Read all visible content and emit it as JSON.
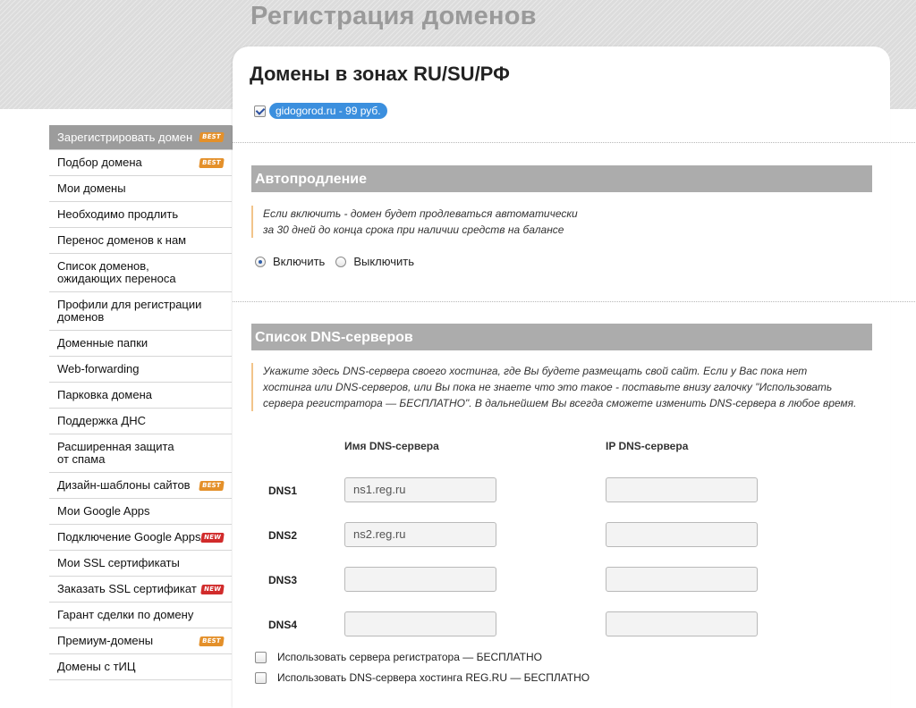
{
  "header": {
    "title": "Регистрация доменов"
  },
  "sidebar": {
    "items": [
      {
        "label": "Зарегистрировать домен",
        "badge": "BEST",
        "active": true
      },
      {
        "label": "Подбор домена",
        "badge": "BEST"
      },
      {
        "label": "Мои домены"
      },
      {
        "label": "Необходимо продлить"
      },
      {
        "label": "Перенос доменов к нам"
      },
      {
        "label": "Список доменов, ожидающих переноса"
      },
      {
        "label": "Профили для регистрации доменов"
      },
      {
        "label": "Доменные папки"
      },
      {
        "label": "Web-forwarding"
      },
      {
        "label": "Парковка домена"
      },
      {
        "label": "Поддержка ДНС"
      },
      {
        "label": "Расширенная защита от спама"
      },
      {
        "label": "Дизайн-шаблоны сайтов",
        "badge": "BEST"
      },
      {
        "label": "Мои Google Apps"
      },
      {
        "label": "Подключение Google Apps",
        "badge": "NEW"
      },
      {
        "label": "Мои SSL сертификаты"
      },
      {
        "label": "Заказать SSL сертификат",
        "badge": "NEW"
      },
      {
        "label": "Гарант сделки по домену"
      },
      {
        "label": "Премиум-домены",
        "badge": "BEST"
      },
      {
        "label": "Домены с тИЦ"
      }
    ]
  },
  "main": {
    "heading": "Домены в зонах RU/SU/РФ",
    "domain": {
      "checked": true,
      "label": "gidogorod.ru - 99 руб."
    },
    "autorenew": {
      "title": "Автопродление",
      "note_line1": "Если включить - домен будет продлеваться автоматически",
      "note_line2": "за 30 дней до конца срока при наличии средств на балансе",
      "option_on": "Включить",
      "option_off": "Выключить",
      "selected": "on"
    },
    "dns": {
      "title": "Список DNS-серверов",
      "note_line1": "Укажите здесь DNS-сервера своего хостинга, где Вы будете размещать свой сайт. Если у Вас пока нет",
      "note_line2": "хостинга или DNS-серверов, или Вы пока не знаете что это такое - поставьте внизу галочку \"Использовать",
      "note_line3": "сервера регистратора — БЕСПЛАТНО\". В дальнейшем Вы всегда сможете изменить DNS-сервера в любое время.",
      "col_name": "Имя DNS-сервера",
      "col_ip": "IP DNS-сервера",
      "rows": [
        {
          "label": "DNS1",
          "name": "ns1.reg.ru",
          "ip": ""
        },
        {
          "label": "DNS2",
          "name": "ns2.reg.ru",
          "ip": ""
        },
        {
          "label": "DNS3",
          "name": "",
          "ip": ""
        },
        {
          "label": "DNS4",
          "name": "",
          "ip": ""
        }
      ],
      "use_registrar": "Использовать сервера регистратора — БЕСПЛАТНО",
      "use_hosting": "Использовать DNS-сервера хостинга REG.RU — БЕСПЛАТНО"
    }
  },
  "colors": {
    "accent": "#3b8fde",
    "section_bar": "#acacac",
    "badge_best": "#e4902a",
    "badge_new": "#d12b2b"
  }
}
